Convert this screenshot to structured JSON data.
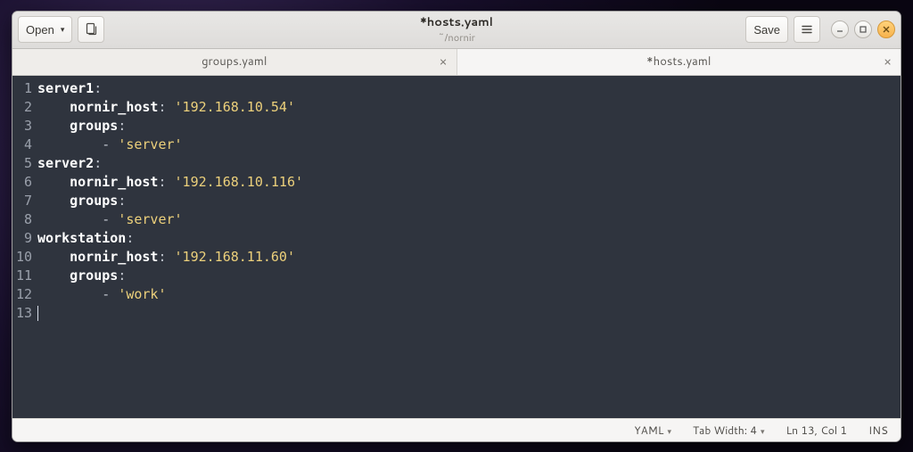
{
  "title": "*hosts.yaml",
  "subtitle": "~/nornir",
  "toolbar": {
    "open_label": "Open",
    "save_label": "Save"
  },
  "tabs": [
    {
      "label": "groups.yaml",
      "active": false
    },
    {
      "label": "*hosts.yaml",
      "active": true
    }
  ],
  "code_lines": [
    {
      "n": 1,
      "tokens": [
        {
          "t": "server1",
          "c": "k-key"
        },
        {
          "t": ":",
          "c": "k-col"
        }
      ]
    },
    {
      "n": 2,
      "indent": 4,
      "tokens": [
        {
          "t": "nornir_host",
          "c": "k-key"
        },
        {
          "t": ": ",
          "c": "k-col"
        },
        {
          "t": "'192.168.10.54'",
          "c": "k-str"
        }
      ]
    },
    {
      "n": 3,
      "indent": 4,
      "tokens": [
        {
          "t": "groups",
          "c": "k-key"
        },
        {
          "t": ":",
          "c": "k-col"
        }
      ]
    },
    {
      "n": 4,
      "indent": 8,
      "tokens": [
        {
          "t": "- ",
          "c": "k-dash"
        },
        {
          "t": "'server'",
          "c": "k-str"
        }
      ]
    },
    {
      "n": 5,
      "tokens": [
        {
          "t": "server2",
          "c": "k-key"
        },
        {
          "t": ":",
          "c": "k-col"
        }
      ]
    },
    {
      "n": 6,
      "indent": 4,
      "tokens": [
        {
          "t": "nornir_host",
          "c": "k-key"
        },
        {
          "t": ": ",
          "c": "k-col"
        },
        {
          "t": "'192.168.10.116'",
          "c": "k-str"
        }
      ]
    },
    {
      "n": 7,
      "indent": 4,
      "tokens": [
        {
          "t": "groups",
          "c": "k-key"
        },
        {
          "t": ":",
          "c": "k-col"
        }
      ]
    },
    {
      "n": 8,
      "indent": 8,
      "tokens": [
        {
          "t": "- ",
          "c": "k-dash"
        },
        {
          "t": "'server'",
          "c": "k-str"
        }
      ]
    },
    {
      "n": 9,
      "tokens": [
        {
          "t": "workstation",
          "c": "k-key"
        },
        {
          "t": ":",
          "c": "k-col"
        }
      ]
    },
    {
      "n": 10,
      "indent": 4,
      "tokens": [
        {
          "t": "nornir_host",
          "c": "k-key"
        },
        {
          "t": ": ",
          "c": "k-col"
        },
        {
          "t": "'192.168.11.60'",
          "c": "k-str"
        }
      ]
    },
    {
      "n": 11,
      "indent": 4,
      "tokens": [
        {
          "t": "groups",
          "c": "k-key"
        },
        {
          "t": ":",
          "c": "k-col"
        }
      ]
    },
    {
      "n": 12,
      "indent": 8,
      "tokens": [
        {
          "t": "- ",
          "c": "k-dash"
        },
        {
          "t": "'work'",
          "c": "k-str"
        }
      ]
    },
    {
      "n": 13,
      "cursor": true,
      "tokens": []
    }
  ],
  "status": {
    "lang": "YAML",
    "tabwidth": "Tab Width: 4",
    "pos": "Ln 13, Col 1",
    "mode": "INS"
  }
}
